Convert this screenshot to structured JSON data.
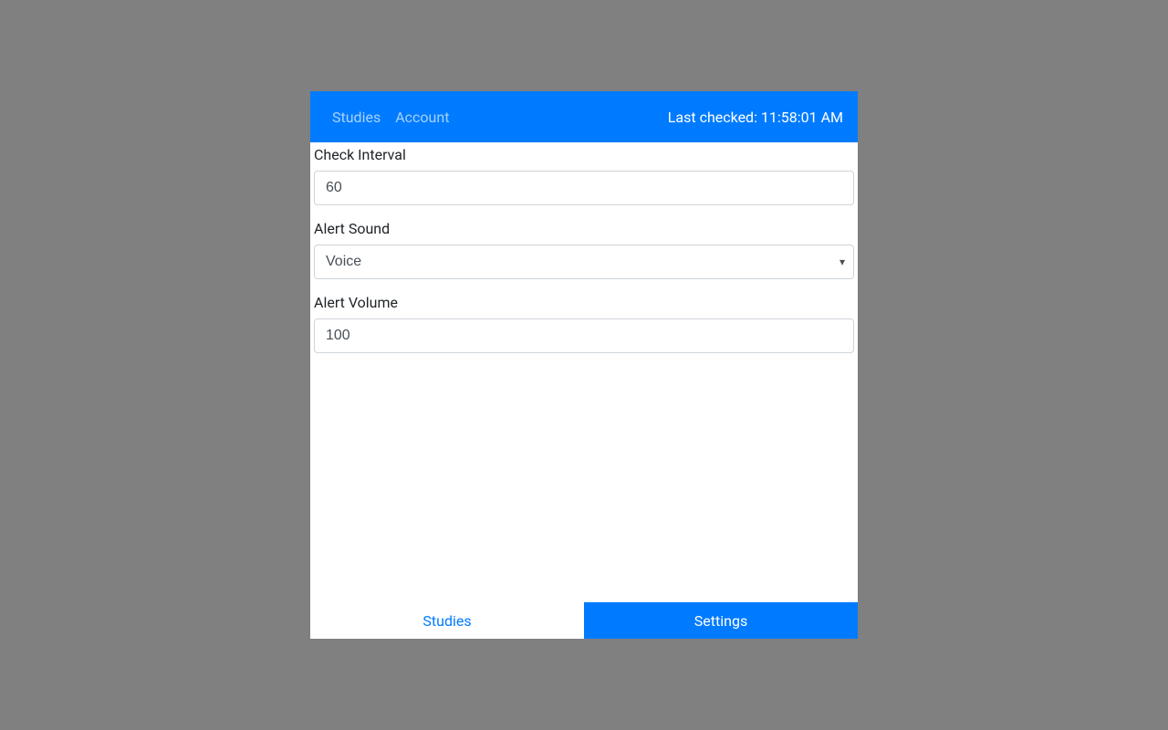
{
  "header": {
    "nav": {
      "studies": "Studies",
      "account": "Account"
    },
    "status": "Last checked: 11:58:01 AM"
  },
  "form": {
    "check_interval": {
      "label": "Check Interval",
      "value": "60"
    },
    "alert_sound": {
      "label": "Alert Sound",
      "value": "Voice"
    },
    "alert_volume": {
      "label": "Alert Volume",
      "value": "100"
    }
  },
  "tabs": {
    "studies": "Studies",
    "settings": "Settings"
  }
}
